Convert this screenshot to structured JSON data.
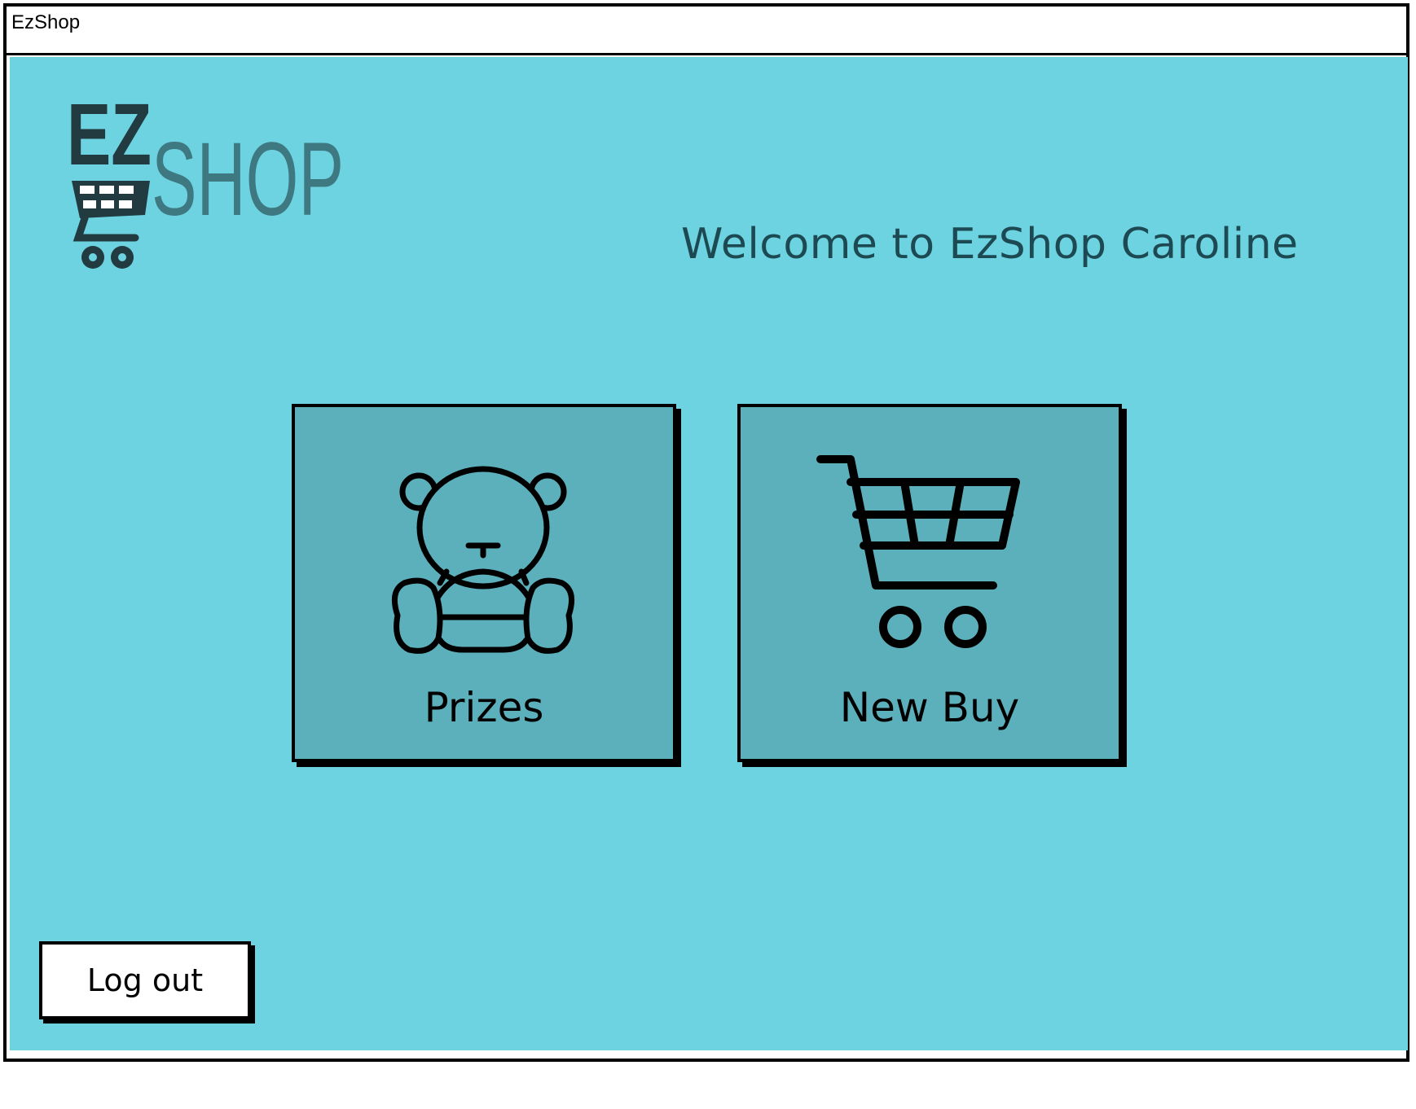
{
  "window": {
    "title": "EzShop"
  },
  "colors": {
    "background": "#6dd3e1",
    "tile": "#5cb0bc",
    "heading": "#1d4a52",
    "logo_dark": "#213b40",
    "logo_light": "#3e7880"
  },
  "logo": {
    "part1": "EZ",
    "part2": "SHOP",
    "icon": "shopping-cart-icon"
  },
  "header": {
    "welcome": "Welcome to EzShop Caroline"
  },
  "tiles": [
    {
      "label": "Prizes",
      "icon": "teddy-bear-icon"
    },
    {
      "label": "New Buy",
      "icon": "shopping-cart-icon"
    }
  ],
  "footer": {
    "logout_label": "Log out"
  }
}
